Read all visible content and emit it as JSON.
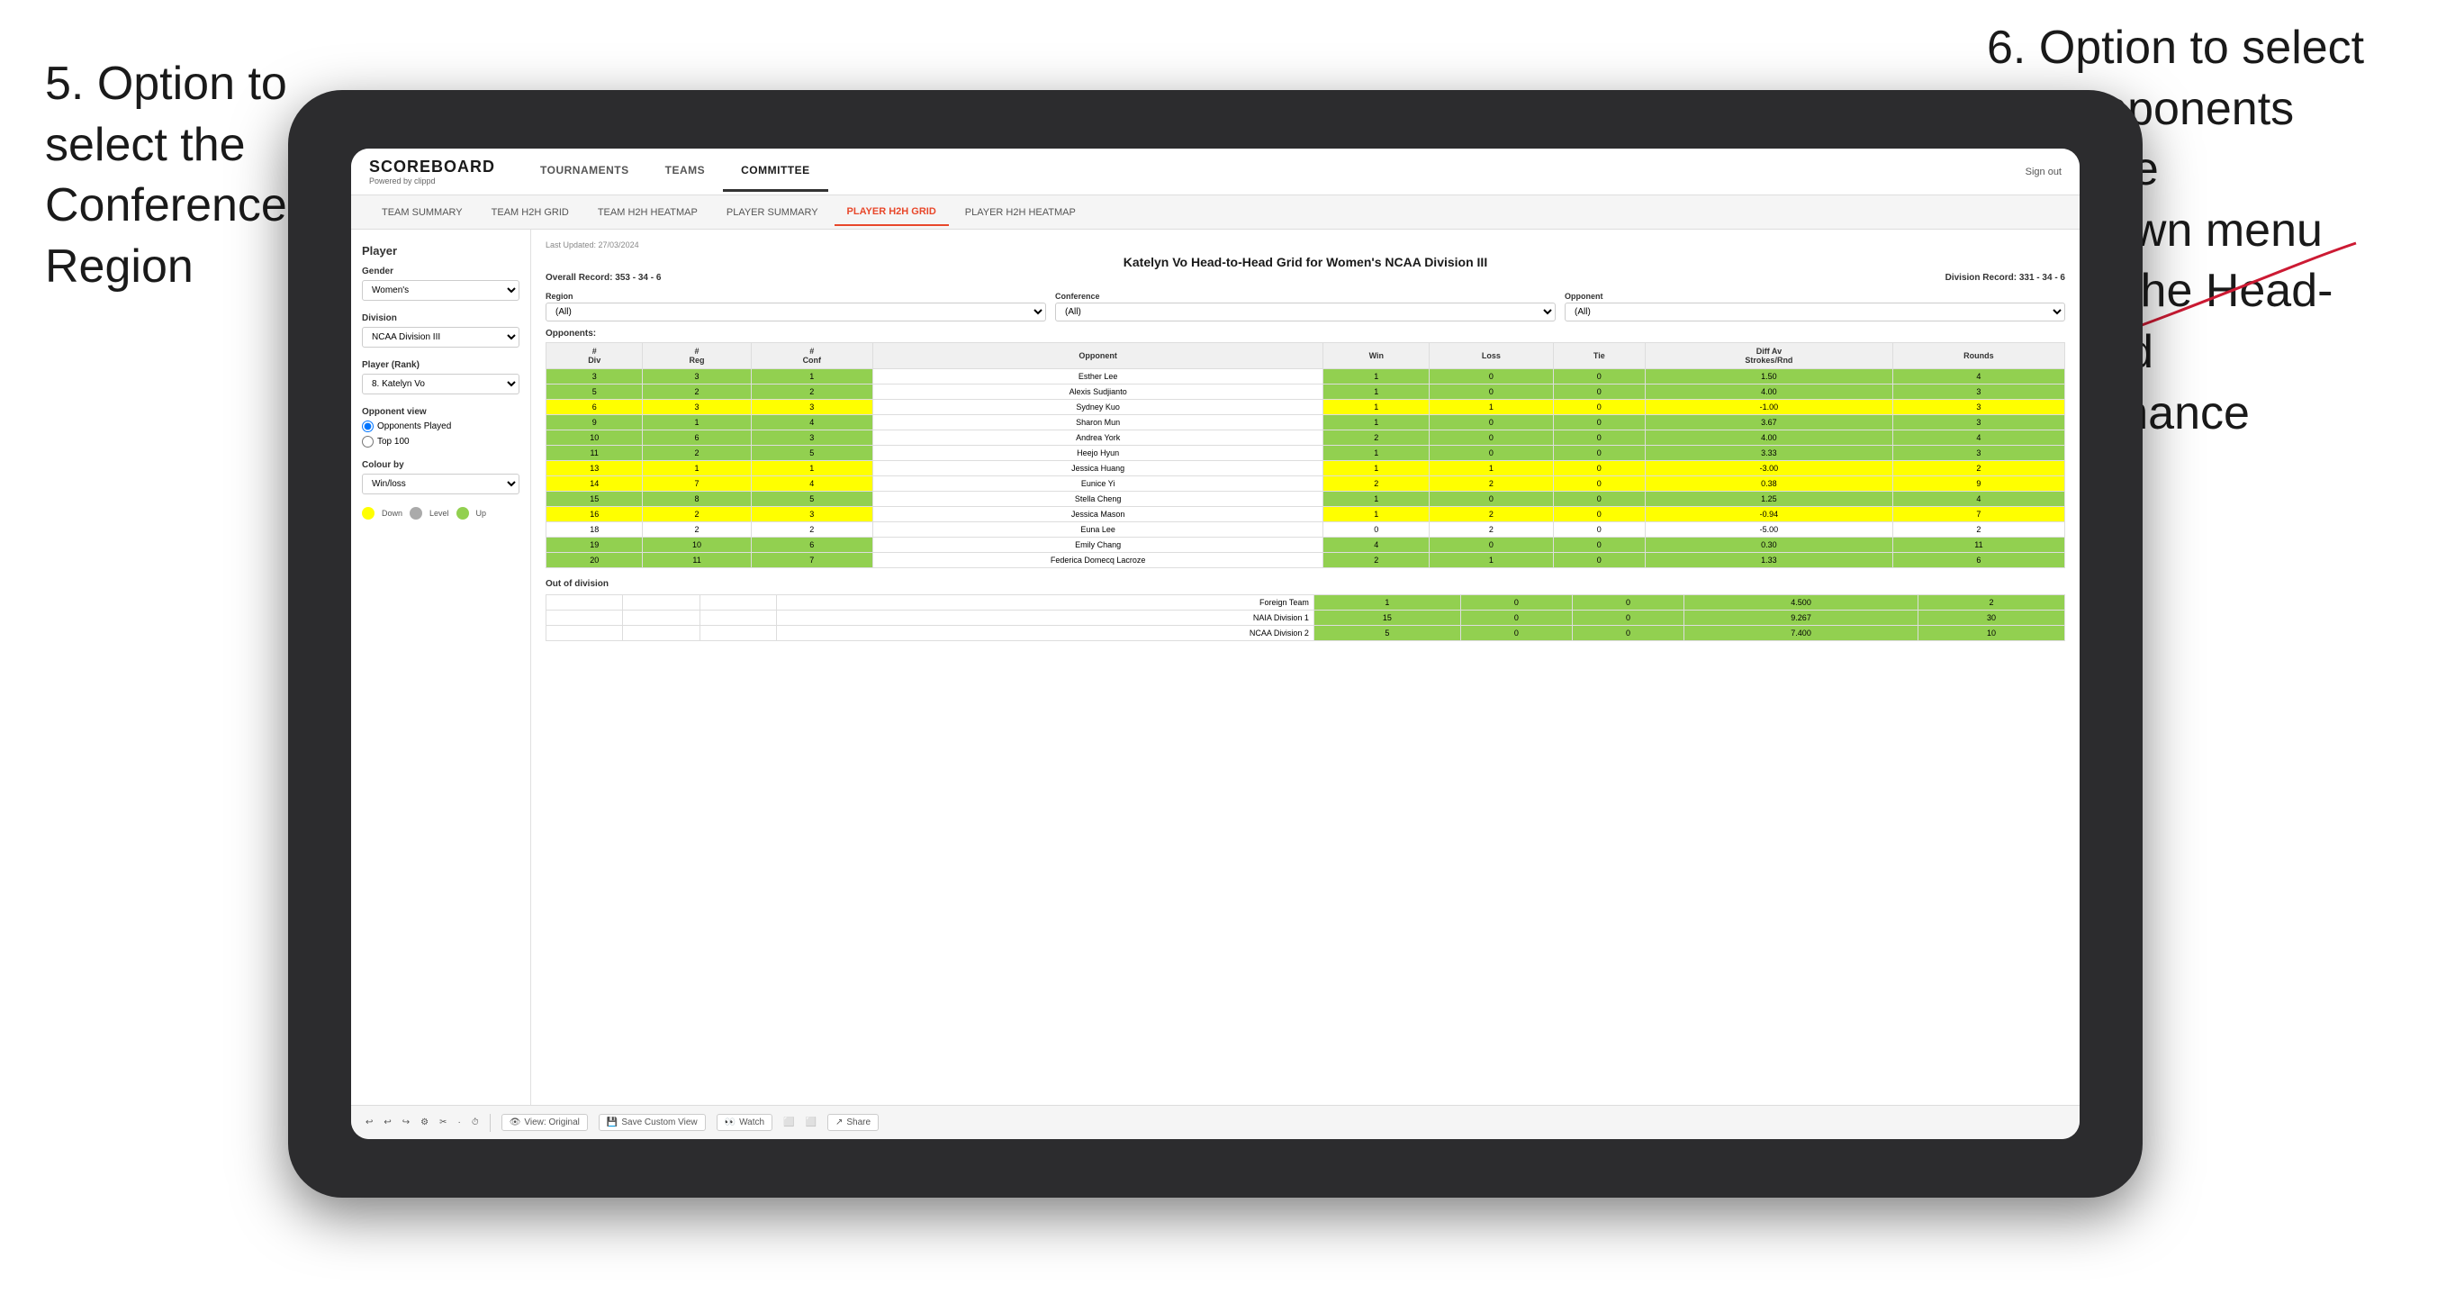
{
  "annotations": {
    "left": {
      "line1": "5. Option to",
      "line2": "select the",
      "line3": "Conference and",
      "line4": "Region"
    },
    "right": {
      "line1": "6. Option to select",
      "line2": "the Opponents",
      "line3": "from the",
      "line4": "dropdown menu",
      "line5": "to see the Head-",
      "line6": "to-Head",
      "line7": "performance"
    }
  },
  "header": {
    "logo": "SCOREBOARD",
    "logo_sub": "Powered by clippd",
    "nav_items": [
      "TOURNAMENTS",
      "TEAMS",
      "COMMITTEE"
    ],
    "sign_out": "Sign out"
  },
  "sub_nav": {
    "tabs": [
      "TEAM SUMMARY",
      "TEAM H2H GRID",
      "TEAM H2H HEATMAP",
      "PLAYER SUMMARY",
      "PLAYER H2H GRID",
      "PLAYER H2H HEATMAP"
    ],
    "active": "PLAYER H2H GRID"
  },
  "sidebar": {
    "player_label": "Player",
    "gender_label": "Gender",
    "gender_value": "Women's",
    "division_label": "Division",
    "division_value": "NCAA Division III",
    "player_rank_label": "Player (Rank)",
    "player_rank_value": "8. Katelyn Vo",
    "opponent_view_label": "Opponent view",
    "radio1": "Opponents Played",
    "radio2": "Top 100",
    "colour_by_label": "Colour by",
    "colour_value": "Win/loss",
    "color_down": "Down",
    "color_level": "Level",
    "color_up": "Up"
  },
  "content": {
    "last_updated": "Last Updated: 27/03/2024",
    "title": "Katelyn Vo Head-to-Head Grid for Women's NCAA Division III",
    "overall_record": "Overall Record: 353 - 34 - 6",
    "division_record": "Division Record: 331 - 34 - 6",
    "filter_region_label": "Region",
    "filter_conf_label": "Conference",
    "filter_opp_label": "Opponent",
    "opponents_label": "Opponents:",
    "filter_all": "(All)",
    "col_headers": [
      "#\nDiv",
      "#\nReg",
      "#\nConf",
      "Opponent",
      "Win",
      "Loss",
      "Tie",
      "Diff Av\nStrokes/Rnd",
      "Rounds"
    ],
    "rows": [
      {
        "div": 3,
        "reg": 3,
        "conf": 1,
        "opponent": "Esther Lee",
        "win": 1,
        "loss": 0,
        "tie": 0,
        "diff": 1.5,
        "rounds": 4,
        "color": "green"
      },
      {
        "div": 5,
        "reg": 2,
        "conf": 2,
        "opponent": "Alexis Sudjianto",
        "win": 1,
        "loss": 0,
        "tie": 0,
        "diff": 4.0,
        "rounds": 3,
        "color": "green"
      },
      {
        "div": 6,
        "reg": 3,
        "conf": 3,
        "opponent": "Sydney Kuo",
        "win": 1,
        "loss": 1,
        "tie": 0,
        "diff": -1.0,
        "rounds": 3,
        "color": "yellow"
      },
      {
        "div": 9,
        "reg": 1,
        "conf": 4,
        "opponent": "Sharon Mun",
        "win": 1,
        "loss": 0,
        "tie": 0,
        "diff": 3.67,
        "rounds": 3,
        "color": "green"
      },
      {
        "div": 10,
        "reg": 6,
        "conf": 3,
        "opponent": "Andrea York",
        "win": 2,
        "loss": 0,
        "tie": 0,
        "diff": 4.0,
        "rounds": 4,
        "color": "green"
      },
      {
        "div": 11,
        "reg": 2,
        "conf": 5,
        "opponent": "Heejo Hyun",
        "win": 1,
        "loss": 0,
        "tie": 0,
        "diff": 3.33,
        "rounds": 3,
        "color": "green"
      },
      {
        "div": 13,
        "reg": 1,
        "conf": 1,
        "opponent": "Jessica Huang",
        "win": 1,
        "loss": 1,
        "tie": 0,
        "diff": -3.0,
        "rounds": 2,
        "color": "yellow"
      },
      {
        "div": 14,
        "reg": 7,
        "conf": 4,
        "opponent": "Eunice Yi",
        "win": 2,
        "loss": 2,
        "tie": 0,
        "diff": 0.38,
        "rounds": 9,
        "color": "yellow"
      },
      {
        "div": 15,
        "reg": 8,
        "conf": 5,
        "opponent": "Stella Cheng",
        "win": 1,
        "loss": 0,
        "tie": 0,
        "diff": 1.25,
        "rounds": 4,
        "color": "green"
      },
      {
        "div": 16,
        "reg": 2,
        "conf": 3,
        "opponent": "Jessica Mason",
        "win": 1,
        "loss": 2,
        "tie": 0,
        "diff": -0.94,
        "rounds": 7,
        "color": "yellow"
      },
      {
        "div": 18,
        "reg": 2,
        "conf": 2,
        "opponent": "Euna Lee",
        "win": 0,
        "loss": 2,
        "tie": 0,
        "diff": -5.0,
        "rounds": 2,
        "color": "white"
      },
      {
        "div": 19,
        "reg": 10,
        "conf": 6,
        "opponent": "Emily Chang",
        "win": 4,
        "loss": 0,
        "tie": 0,
        "diff": 0.3,
        "rounds": 11,
        "color": "green"
      },
      {
        "div": 20,
        "reg": 11,
        "conf": 7,
        "opponent": "Federica Domecq Lacroze",
        "win": 2,
        "loss": 1,
        "tie": 0,
        "diff": 1.33,
        "rounds": 6,
        "color": "green"
      }
    ],
    "out_of_division": "Out of division",
    "ood_rows": [
      {
        "label": "Foreign Team",
        "win": 1,
        "loss": 0,
        "tie": 0,
        "diff": 4.5,
        "rounds": 2,
        "color": "green"
      },
      {
        "label": "NAIA Division 1",
        "win": 15,
        "loss": 0,
        "tie": 0,
        "diff": 9.267,
        "rounds": 30,
        "color": "green"
      },
      {
        "label": "NCAA Division 2",
        "win": 5,
        "loss": 0,
        "tie": 0,
        "diff": 7.4,
        "rounds": 10,
        "color": "green"
      }
    ]
  },
  "toolbar": {
    "view_original": "View: Original",
    "save_custom": "Save Custom View",
    "watch": "Watch",
    "share": "Share"
  }
}
